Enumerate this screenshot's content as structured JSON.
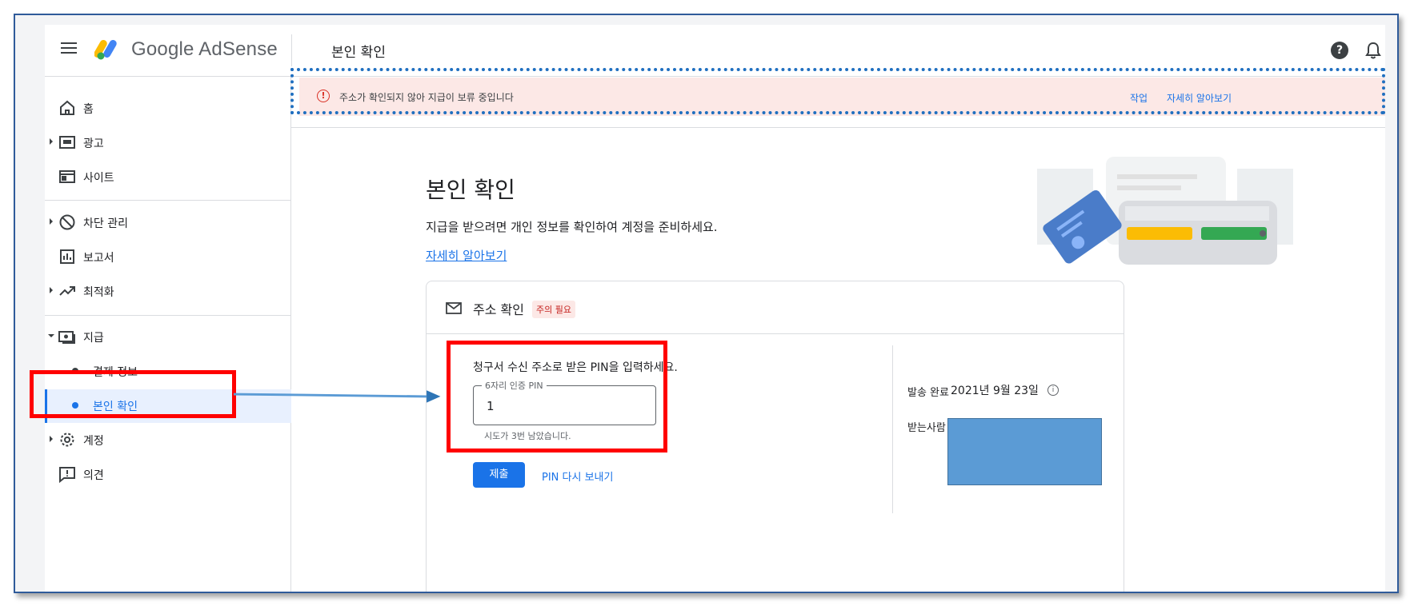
{
  "header": {
    "brand": "Google AdSense",
    "page_title": "본인 확인",
    "help_glyph": "?"
  },
  "sidebar": {
    "items": [
      {
        "label": "홈",
        "icon": "home-icon"
      },
      {
        "label": "광고",
        "icon": "ads-icon"
      },
      {
        "label": "사이트",
        "icon": "sites-icon"
      },
      {
        "label": "차단 관리",
        "icon": "block-icon"
      },
      {
        "label": "보고서",
        "icon": "reports-icon"
      },
      {
        "label": "최적화",
        "icon": "trending-icon"
      },
      {
        "label": "지급",
        "icon": "payments-icon"
      },
      {
        "label": "결제 정보"
      },
      {
        "label": "본인 확인"
      },
      {
        "label": "계정",
        "icon": "gear-icon"
      },
      {
        "label": "의견",
        "icon": "feedback-icon"
      }
    ]
  },
  "alert": {
    "icon_glyph": "!",
    "message": "주소가 확인되지 않아 지급이 보류 중입니다",
    "action_label": "작업",
    "learn_more_label": "자세히 알아보기"
  },
  "main": {
    "title": "본인 확인",
    "description": "지급을 받으려면 개인 정보를 확인하여 계정을 준비하세요.",
    "learn_more_link": "자세히 알아보기"
  },
  "address_card": {
    "title": "주소 확인",
    "badge": "주의 필요",
    "pin_prompt": "청구서 수신 주소로 받은 PIN을 입력하세요.",
    "pin_field_label": "6자리 인증 PIN",
    "pin_field_value": "1",
    "pin_hint": "시도가 3번 남았습니다.",
    "submit_label": "제출",
    "resend_label": "PIN 다시 보내기",
    "sent_label": "발송 완료",
    "sent_date": "2021년 9월 23일",
    "info_glyph": "i",
    "recipient_label": "받는사람"
  },
  "colors": {
    "accent": "#1a73e8",
    "alert_bg": "#fce8e6",
    "annotation_red": "#ff0000",
    "annotation_arrow": "#5b9bd5"
  }
}
